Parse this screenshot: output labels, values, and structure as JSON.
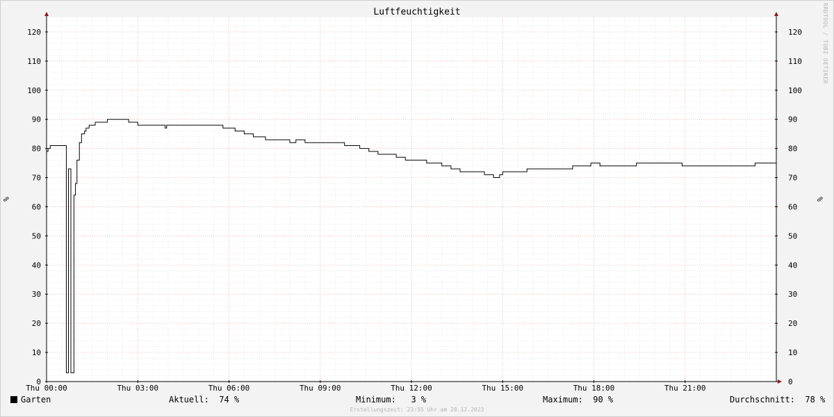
{
  "chart_data": {
    "type": "line",
    "title": "Luftfeuchtigkeit",
    "ylabel_left": "%",
    "ylabel_right": "%",
    "ylim": [
      0,
      125
    ],
    "yticks": [
      0,
      10,
      20,
      30,
      40,
      50,
      60,
      70,
      80,
      90,
      100,
      110,
      120
    ],
    "xlim_hours": [
      0,
      24
    ],
    "xticks": [
      {
        "h": 0,
        "label": "Thu 00:00"
      },
      {
        "h": 3,
        "label": "Thu 03:00"
      },
      {
        "h": 6,
        "label": "Thu 06:00"
      },
      {
        "h": 9,
        "label": "Thu 09:00"
      },
      {
        "h": 12,
        "label": "Thu 12:00"
      },
      {
        "h": 15,
        "label": "Thu 15:00"
      },
      {
        "h": 18,
        "label": "Thu 18:00"
      },
      {
        "h": 21,
        "label": "Thu 21:00"
      }
    ],
    "grid": true,
    "series": [
      {
        "name": "Garten",
        "color": "#000000",
        "hours": [
          0.0,
          0.05,
          0.12,
          0.2,
          0.35,
          0.5,
          0.62,
          0.65,
          0.68,
          0.72,
          0.78,
          0.8,
          0.85,
          0.9,
          0.95,
          1.0,
          1.08,
          1.15,
          1.25,
          1.3,
          1.4,
          1.5,
          1.6,
          1.7,
          1.8,
          2.0,
          2.2,
          2.4,
          2.7,
          3.0,
          3.3,
          3.6,
          3.9,
          3.95,
          4.0,
          4.2,
          5.0,
          5.5,
          5.8,
          6.0,
          6.2,
          6.5,
          6.8,
          7.2,
          7.5,
          7.8,
          8.0,
          8.2,
          8.5,
          9.0,
          9.5,
          9.8,
          10.0,
          10.3,
          10.6,
          10.9,
          11.2,
          11.5,
          11.8,
          12.0,
          12.2,
          12.5,
          12.8,
          13.0,
          13.3,
          13.6,
          13.9,
          14.1,
          14.4,
          14.7,
          14.9,
          15.0,
          15.2,
          15.5,
          15.8,
          16.0,
          16.2,
          16.5,
          16.8,
          17.0,
          17.3,
          17.6,
          17.9,
          18.2,
          18.5,
          18.8,
          19.1,
          19.4,
          19.7,
          20.0,
          20.3,
          20.6,
          20.9,
          21.2,
          21.5,
          21.8,
          22.1,
          22.4,
          22.7,
          23.0,
          23.3,
          23.6,
          23.9,
          24.0
        ],
        "values": [
          79,
          80,
          81,
          81,
          81,
          81,
          81,
          3,
          3,
          73,
          73,
          3,
          3,
          64,
          68,
          76,
          82,
          85,
          86,
          87,
          88,
          88,
          89,
          89,
          89,
          90,
          90,
          90,
          89,
          88,
          88,
          88,
          87,
          88,
          88,
          88,
          88,
          88,
          87,
          87,
          86,
          85,
          84,
          83,
          83,
          83,
          82,
          83,
          82,
          82,
          82,
          81,
          81,
          80,
          79,
          78,
          78,
          77,
          76,
          76,
          76,
          75,
          75,
          74,
          73,
          72,
          72,
          72,
          71,
          70,
          71,
          72,
          72,
          72,
          73,
          73,
          73,
          73,
          73,
          73,
          74,
          74,
          75,
          74,
          74,
          74,
          74,
          75,
          75,
          75,
          75,
          75,
          74,
          74,
          74,
          74,
          74,
          74,
          74,
          74,
          75,
          75,
          75,
          74
        ]
      }
    ]
  },
  "legend": {
    "name": "Garten",
    "aktuell": "Aktuell:  74 %",
    "minimum": "Minimum:   3 %",
    "maximum": "Maximum:  90 %",
    "durchschnitt": "Durchschnitt:  78 %"
  },
  "footer_text": "Erstellungszeit: 23:55 Uhr am 28.12.2023",
  "side_note": "RRDTOOL / TOBI OETIKER"
}
